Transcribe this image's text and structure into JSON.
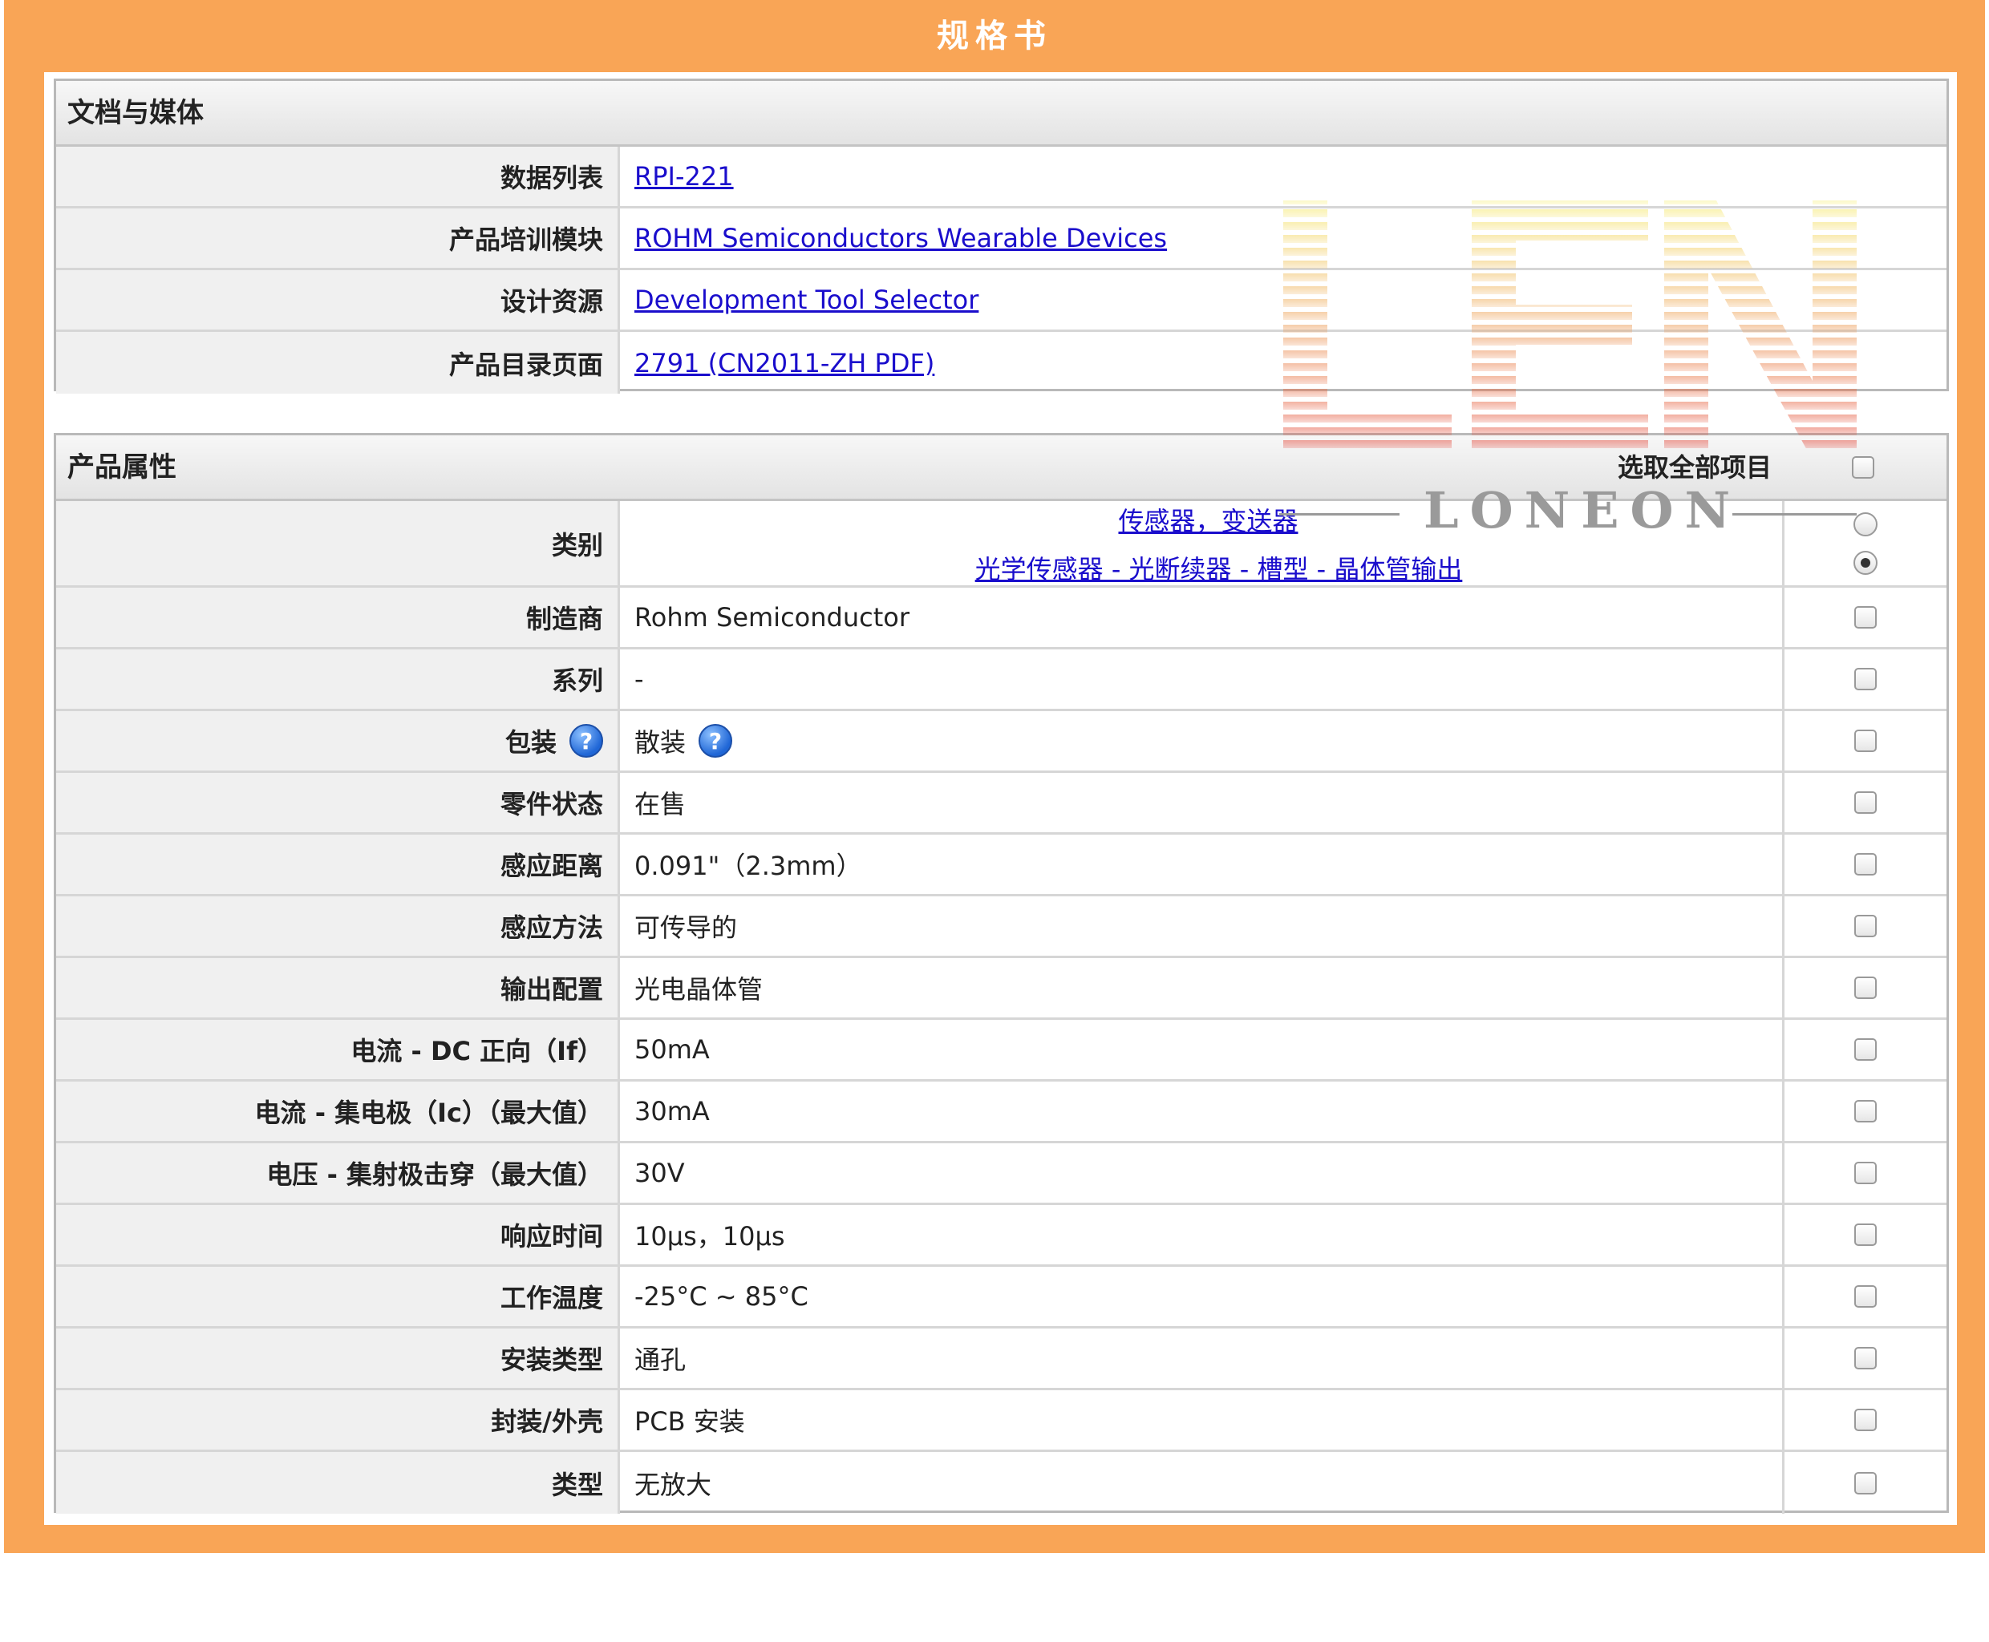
{
  "banner": {
    "title": "规格书"
  },
  "docs": {
    "title": "文档与媒体",
    "rows": [
      {
        "label": "数据列表",
        "value": "RPI-221"
      },
      {
        "label": "产品培训模块",
        "value": "ROHM Semiconductors Wearable Devices"
      },
      {
        "label": "设计资源",
        "value": "Development Tool Selector"
      },
      {
        "label": "产品目录页面",
        "value": "2791 (CN2011-ZH PDF)"
      }
    ]
  },
  "props": {
    "title": "产品属性",
    "select_all": "选取全部项目",
    "category": {
      "label": "类别",
      "line1": "传感器，变送器",
      "line2": "光学传感器 - 光断续器 - 槽型 - 晶体管输出"
    },
    "rows": [
      {
        "label": "制造商",
        "value": "Rohm Semiconductor"
      },
      {
        "label": "系列",
        "value": "-"
      },
      {
        "label": "包装",
        "value": "散装"
      },
      {
        "label": "零件状态",
        "value": "在售"
      },
      {
        "label": "感应距离",
        "value": "0.091\"（2.3mm）"
      },
      {
        "label": "感应方法",
        "value": "可传导的"
      },
      {
        "label": "输出配置",
        "value": "光电晶体管"
      },
      {
        "label": "电流 - DC 正向（If）",
        "value": "50mA"
      },
      {
        "label": "电流 - 集电极（Ic）（最大值）",
        "value": "30mA"
      },
      {
        "label": "电压 - 集射极击穿（最大值）",
        "value": "30V"
      },
      {
        "label": "响应时间",
        "value": "10µs，10µs"
      },
      {
        "label": "工作温度",
        "value": "-25°C ~ 85°C"
      },
      {
        "label": "安装类型",
        "value": "通孔"
      },
      {
        "label": "封装/外壳",
        "value": "PCB 安装"
      },
      {
        "label": "类型",
        "value": "无放大"
      }
    ],
    "help_glyph": "?"
  },
  "watermark": {
    "logo": "LEN",
    "brand": "LONEON"
  },
  "colors": {
    "frame": "#F9A556",
    "link": "#1A0DCC",
    "label_bg": "#F0F0F0"
  }
}
